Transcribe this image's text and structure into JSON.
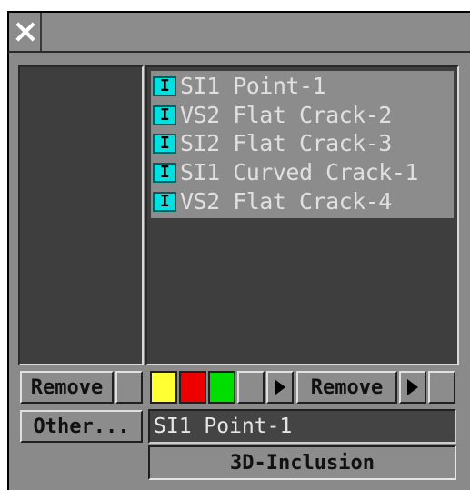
{
  "window": {
    "close_icon": "close-icon",
    "title": ""
  },
  "object_list": {
    "items": [
      {
        "badge": "I",
        "label": "SI1 Point-1"
      },
      {
        "badge": "I",
        "label": "VS2 Flat Crack-2"
      },
      {
        "badge": "I",
        "label": "SI2 Flat Crack-3"
      },
      {
        "badge": "I",
        "label": "SI1 Curved Crack-1"
      },
      {
        "badge": "I",
        "label": "VS2 Flat Crack-4"
      }
    ]
  },
  "controls": {
    "left_remove_label": "Remove",
    "right_remove_label": "Remove",
    "other_label": "Other...",
    "selected_name": "SI1 Point-1",
    "type_label": "3D-Inclusion",
    "swatch_colors": [
      "#ffff33",
      "#ee0000",
      "#00dd00"
    ],
    "play_icon": "play-icon"
  }
}
